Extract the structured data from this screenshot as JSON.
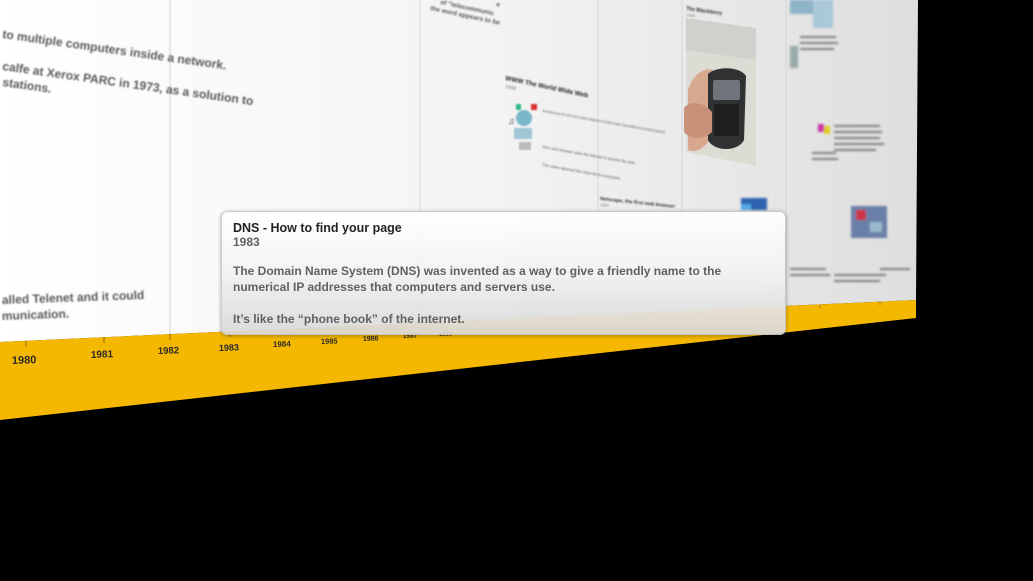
{
  "timeline": {
    "years": [
      "1980",
      "1981",
      "1982",
      "1983",
      "1984",
      "1985",
      "1986",
      "1987",
      "1988"
    ],
    "accent_color": "#f5b800"
  },
  "background_text": {
    "left_line_1": "to multiple computers inside a network.",
    "left_line_2": "calfe at Xerox PARC in 1973, as a solution to",
    "left_line_3": "stations.",
    "left_line_4": "alled Telenet and it could",
    "left_line_5": "munication.",
    "top_fragment_1": "e",
    "top_fragment_2": "of \"telecommunic",
    "top_fragment_3": "the word appears to be"
  },
  "cards": {
    "www_title": "WWW The World Wide Web",
    "www_year": "1990",
    "www_para1": "The world wide web ('www, W3' or 'web' for short) is a collection of webpages found on this network of computers. They are identified by URLs and are linked by hypertext links.",
    "www_para2": "Your web browser uses the internet to access the web.",
    "www_para3": "The www opened the internet to everyone.",
    "netscape_title": "Netscape, the first web browser",
    "netscape_year": "1994",
    "device_title": "The Blackberry",
    "device_year": "1999"
  },
  "tooltip": {
    "title": "DNS - How to find your page",
    "year": "1983",
    "body": "The Domain Name System (DNS) was invented as a way to give a friendly name to the numerical IP addresses that computers and servers use.",
    "body2": "It’s like the “phone book” of the internet."
  }
}
